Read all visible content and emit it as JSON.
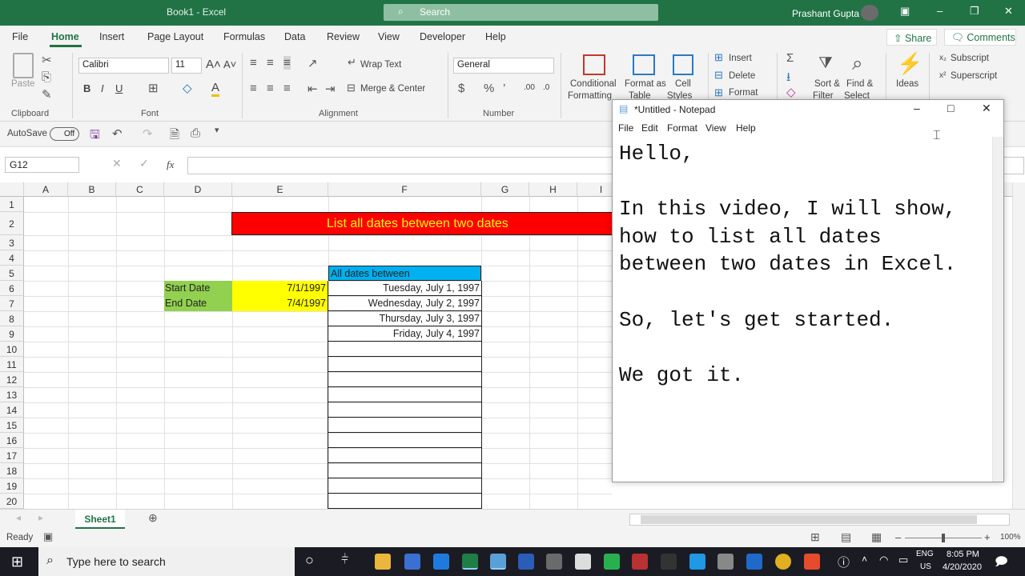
{
  "window": {
    "title": "Book1  -  Excel",
    "search_placeholder": "Search",
    "user": "Prashant Gupta"
  },
  "menu": [
    "File",
    "Home",
    "Insert",
    "Page Layout",
    "Formulas",
    "Data",
    "Review",
    "View",
    "Developer",
    "Help"
  ],
  "share": "Share",
  "comments": "Comments",
  "ribbon": {
    "clipboard": {
      "paste": "Paste",
      "label": "Clipboard"
    },
    "font": {
      "name": "Calibri",
      "size": "11",
      "label": "Font"
    },
    "alignment": {
      "wrap": "Wrap Text",
      "merge": "Merge & Center",
      "label": "Alignment"
    },
    "number": {
      "format": "General",
      "label": "Number"
    },
    "styles": {
      "conditional": "Conditional",
      "formatting": "Formatting",
      "format_as": "Format as",
      "table": "Table",
      "cell": "Cell",
      "styles": "Styles"
    },
    "cells": {
      "insert": "Insert",
      "delete": "Delete",
      "format": "Format"
    },
    "editing": {
      "sort": "Sort &",
      "filter": "Filter",
      "find": "Find &",
      "select": "Select"
    },
    "ideas": "Ideas",
    "subscript": "Subscript",
    "superscript": "Superscript"
  },
  "qat": {
    "autosave": "AutoSave",
    "toggle": "Off"
  },
  "formula": {
    "namebox": "G12",
    "fx": "fx"
  },
  "columns": [
    "A",
    "B",
    "C",
    "D",
    "E",
    "F",
    "G",
    "H",
    "I"
  ],
  "rows": [
    "1",
    "2",
    "3",
    "4",
    "5",
    "6",
    "7",
    "8",
    "9",
    "10",
    "11",
    "12",
    "13",
    "14",
    "15",
    "16",
    "17",
    "18",
    "19",
    "20"
  ],
  "sheet": {
    "title": "List all dates between two dates",
    "header": "All dates between",
    "start_label": "Start Date",
    "start_value": "7/1/1997",
    "end_label": "End Date",
    "end_value": "7/4/1997",
    "dates": [
      "Tuesday, July 1, 1997",
      "Wednesday, July 2, 1997",
      "Thursday, July 3, 1997",
      "Friday, July 4, 1997"
    ]
  },
  "sheet_tab": "Sheet1",
  "status": {
    "ready": "Ready",
    "zoom": "100%"
  },
  "taskbar": {
    "search": "Type here to search",
    "lang1": "ENG",
    "lang2": "US",
    "time": "8:05 PM",
    "date": "4/20/2020"
  },
  "notepad": {
    "title": "*Untitled - Notepad",
    "menu": [
      "File",
      "Edit",
      "Format",
      "View",
      "Help"
    ],
    "lines": [
      "Hello,",
      "",
      "In this video, I will show,",
      "how to list all dates",
      "between two dates in Excel.",
      "",
      "So, let's get started.",
      "",
      "We got it."
    ]
  },
  "colors": {
    "excel_green": "#217346",
    "title_red": "#ff0000",
    "title_text": "#ffff00",
    "header_blue": "#00b0f0",
    "label_green": "#92d050",
    "value_yellow": "#ffff00"
  }
}
